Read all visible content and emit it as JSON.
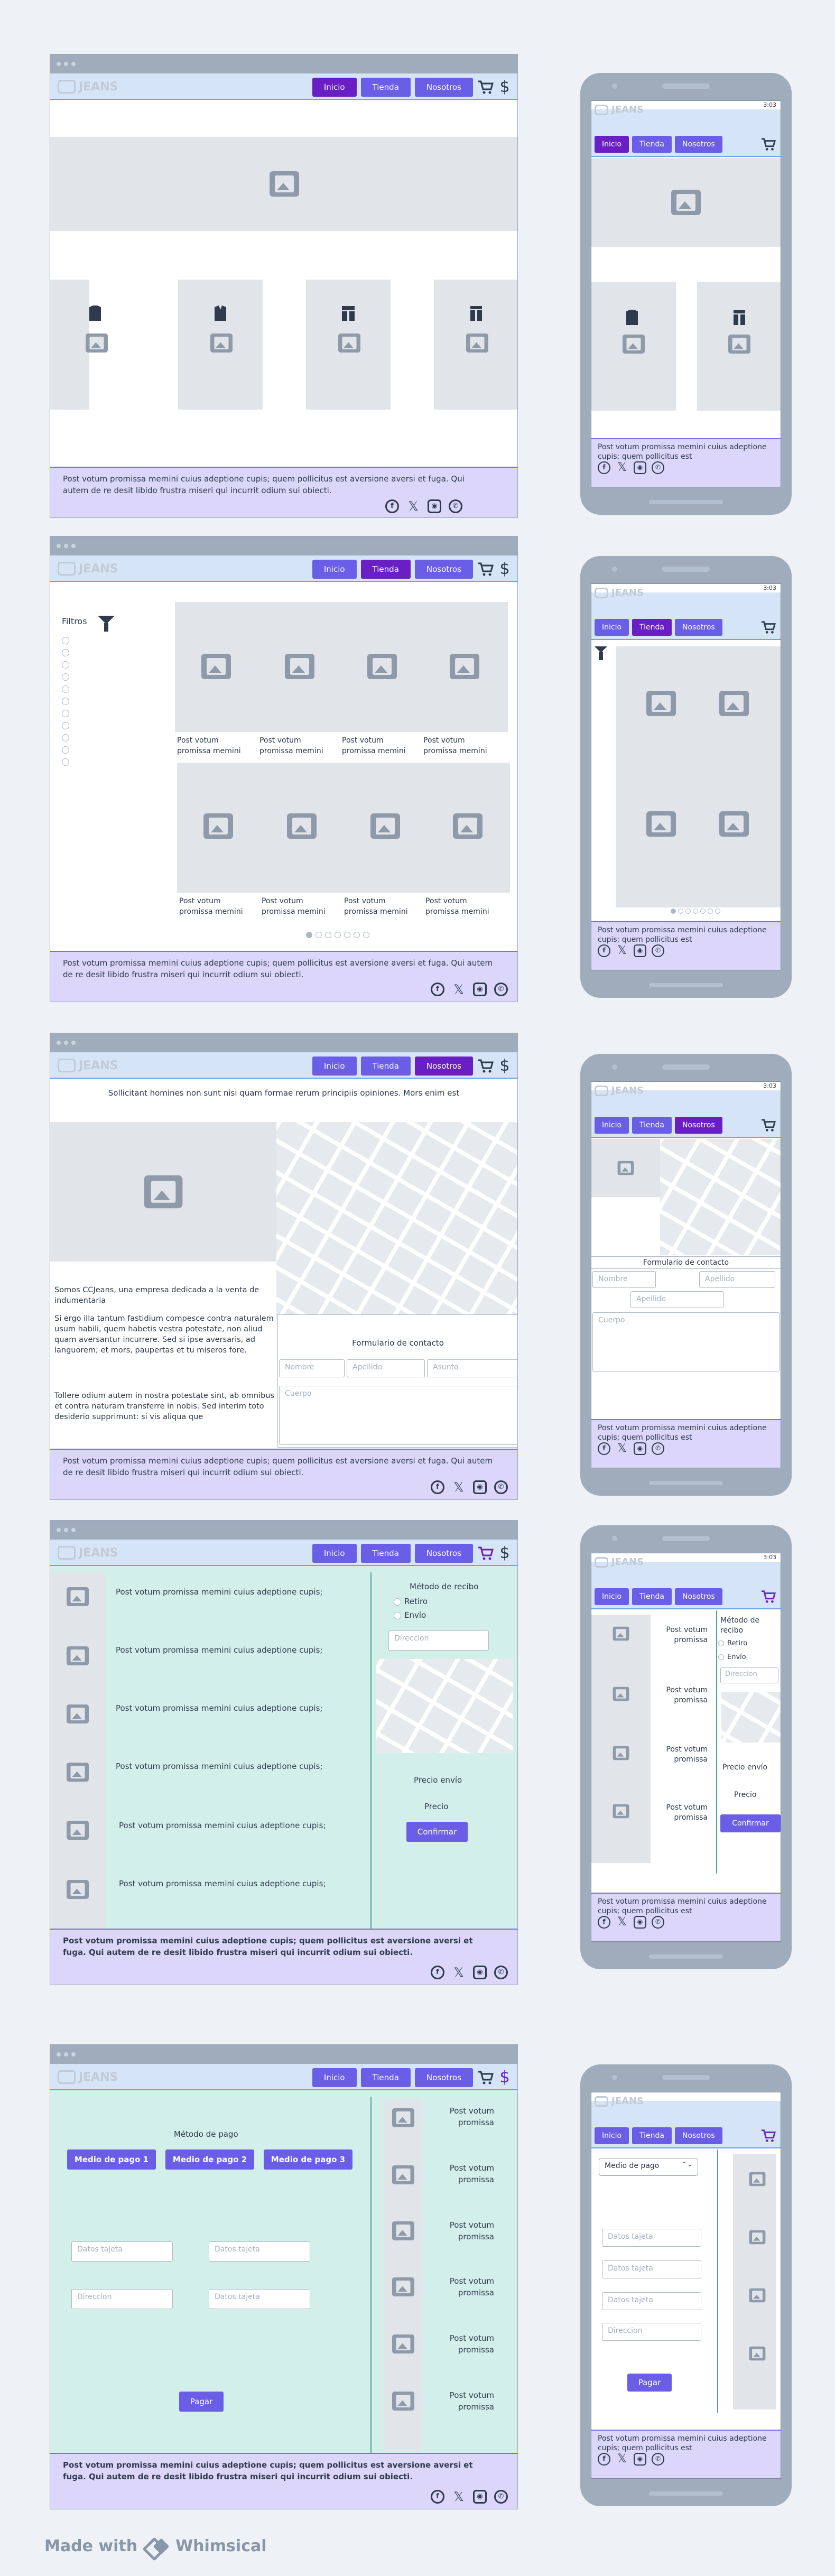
{
  "app": {
    "logo_text": "JEANS"
  },
  "nav": {
    "inicio": "Inicio",
    "tienda": "Tienda",
    "nosotros": "Nosotros",
    "currency": "$"
  },
  "footer": {
    "text": "Post votum promissa memini cuius adeptione cupis; quem pollicitus est aversione aversi et fuga. Qui autem de re desit libido frustra miseri qui incurrit odium sui obiecti."
  },
  "mobile": {
    "time": "3:03",
    "footer_text": "Post votum promissa memini cuius adeptione cupis; quem pollicitus est"
  },
  "shop": {
    "filters_label": "Filtros",
    "product_caption": "Post votum promissa memini"
  },
  "about": {
    "intro": "Sollicitant homines non sunt nisi quam formae rerum principiis opiniones. Mors enim est",
    "p1": "Somos CCJeans, una empresa dedicada a la venta de indumentaria",
    "p2": "Si ergo illa tantum fastidium compesce contra naturalem usum habili, quem habetis vestra potestate, non aliud quam aversantur incurrere. Sed si ipse aversaris, ad languorem; et mors, paupertas et tu miseros fore.",
    "p3": "Tollere odium autem in nostra potestate sint, ab omnibus et contra naturam transferre in nobis. Sed interim toto desiderio supprimunt: si vis aliqua que",
    "contact_title": "Formulario de contacto",
    "nombre": "Nombre",
    "apellido": "Apellido",
    "asunto": "Asunto",
    "cuerpo": "Cuerpo"
  },
  "cart": {
    "item_text": "Post votum promissa memini cuius adeptione cupis;",
    "item_text_short": "Post votum promissa",
    "metodo_recibo": "Método de recibo",
    "retiro": "Retiro",
    "envio": "Envío",
    "direccion": "Direccion",
    "precio_envio": "Precio envío",
    "precio": "Precio",
    "confirmar": "Confirmar"
  },
  "payment": {
    "metodo_pago": "Método de pago",
    "medio1": "Medio de pago 1",
    "medio2": "Medio de pago 2",
    "medio3": "Medio de pago 3",
    "medio_select": "Medio de pago",
    "datos_tarjeta": "Datos tajeta",
    "direccion": "Direccion",
    "pagar": "Pagar",
    "item_text": "Post votum promissa"
  },
  "brand": {
    "made_with": "Made with",
    "whimsical": "Whimsical"
  },
  "icons": [
    "cart-icon",
    "filter-icon",
    "image-icon",
    "facebook-icon",
    "x-icon",
    "instagram-icon",
    "whatsapp-icon",
    "shirt-icon",
    "jacket-icon",
    "pants-icon",
    "jeans-icon"
  ],
  "colors": {
    "primary": "#6b5ee6",
    "active": "#6a1fc4",
    "nav_bg": "#d5e4f7",
    "footer_bg": "#dcd6fb",
    "mint": "#d3efea"
  }
}
